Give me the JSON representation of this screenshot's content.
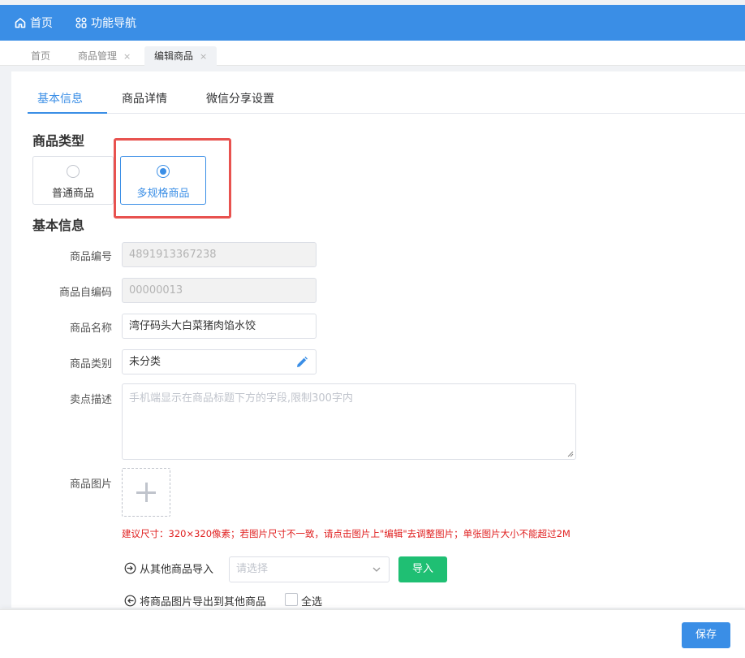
{
  "topbar": {
    "home_label": "首页",
    "nav_label": "功能导航",
    "background": "#3a8ee6"
  },
  "tags": [
    {
      "label": "首页",
      "closable": false
    },
    {
      "label": "商品管理",
      "closable": true
    },
    {
      "label": "编辑商品",
      "closable": true,
      "active": true
    }
  ],
  "tag_close_glyph": "×",
  "tabs": [
    {
      "label": "基本信息",
      "active": true
    },
    {
      "label": "商品详情"
    },
    {
      "label": "微信分享设置"
    }
  ],
  "product_type": {
    "title": "商品类型",
    "options": [
      {
        "label": "普通商品",
        "selected": false
      },
      {
        "label": "多规格商品",
        "selected": true
      }
    ]
  },
  "basic_info": {
    "title": "基本信息",
    "code_label": "商品编号",
    "code_value": "4891913367238",
    "self_code_label": "商品自编码",
    "self_code_value": "00000013",
    "name_label": "商品名称",
    "name_value": "湾仔码头大白菜猪肉馅水饺",
    "category_label": "商品类别",
    "category_value": "未分类",
    "selling_point_label": "卖点描述",
    "selling_point_placeholder": "手机端显示在商品标题下方的字段,限制300字内",
    "image_label": "商品图片",
    "image_hint": "建议尺寸：320×320像素；若图片尺寸不一致，请点击图片上\"编辑\"去调整图片；单张图片大小不能超过2M",
    "import_label": "从其他商品导入",
    "import_placeholder": "请选择",
    "import_button": "导入",
    "export_label": "将商品图片导出到其他商品",
    "select_all_label": "全选"
  },
  "footer": {
    "save_label": "保存"
  },
  "colors": {
    "primary": "#3a8ee6",
    "success": "#1fbf73",
    "danger": "#e02020",
    "highlight": "#e8524f"
  }
}
